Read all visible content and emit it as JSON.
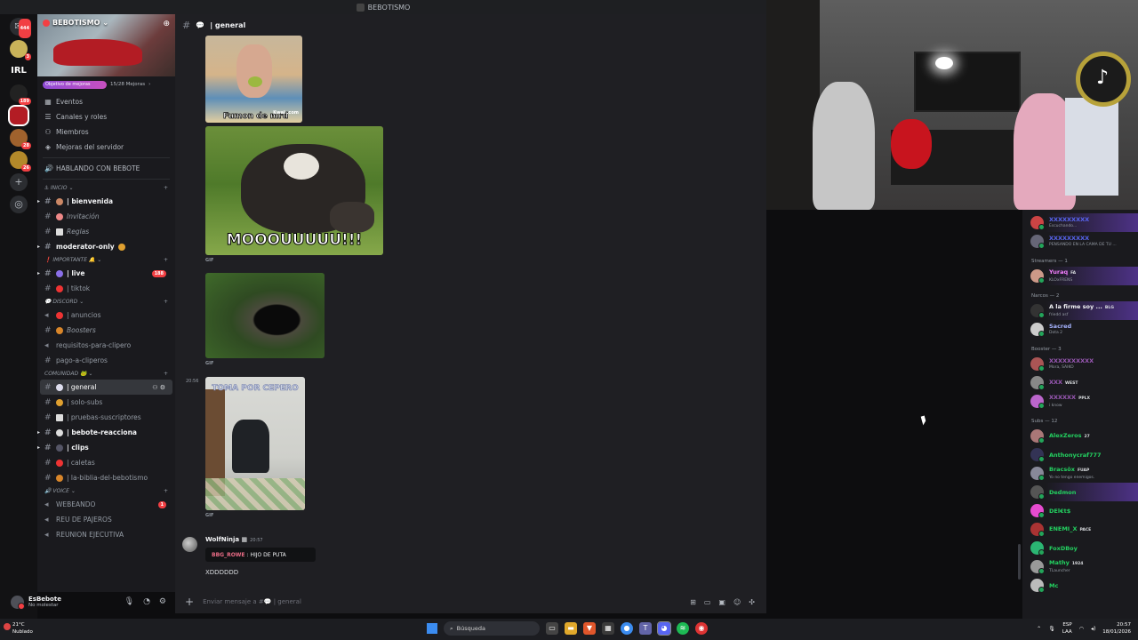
{
  "window": {
    "title": "BEBOTISMO"
  },
  "rail": {
    "badges": [
      "444",
      "3",
      "189",
      "28",
      "26"
    ],
    "irl_label": "IRL"
  },
  "server": {
    "name": "BEBOTISMO",
    "boost_goal": "Objetivo de mejoras",
    "boost_count": "15/28 Mejoras",
    "boost_progress": 0.54
  },
  "menu": [
    {
      "icon": "calendar-icon",
      "label": "Eventos"
    },
    {
      "icon": "list-icon",
      "label": "Canales y roles"
    },
    {
      "icon": "members-icon",
      "label": "Miembros"
    },
    {
      "icon": "boost-icon",
      "label": "Mejoras del servidor"
    }
  ],
  "hablando": "HABLANDO CON BEBOTE",
  "categories": {
    "inicio": "INICIO",
    "importante": "IMPORTANTE",
    "discord": "DISCORD",
    "comunidad": "COMUNIDAD",
    "voice": "VOICE"
  },
  "channels": {
    "bienvenida": "| bienvenida",
    "invitacion": "Invitación",
    "reglas": "Reglas",
    "moderator": "moderator-only",
    "live": "| live",
    "live_count": "188",
    "tiktok": "| tiktok",
    "anuncios": "| anuncios",
    "boosters": "Boosters",
    "requisitos": "requisitos-para-clipero",
    "pago": "pago-a-cliperos",
    "general": "| general",
    "solo_subs": "| solo-subs",
    "pruebas": "| pruebas-suscriptores",
    "reacciona": "| bebote-reacciona",
    "clips": "| clips",
    "caletas": "| caletas",
    "biblia": "| la-biblia-del-bebotismo",
    "webeando": "WEBEANDO",
    "webeando_count": "1",
    "reu": "REU DE PAJEROS",
    "reunion": "REUNION EJECUTIVA"
  },
  "user": {
    "name": "EsBebote",
    "status": "No molestar"
  },
  "chat": {
    "channel_name": "| general",
    "img1_watermark": "Fumon de mrd",
    "img1_wm_site": "Kwai .com",
    "cow_caption": "MOOOUUUUU!!!",
    "gif_label": "GIF",
    "ts_2056": "20:56",
    "room_caption": "TOMA POR CEPERO",
    "author": "WolfNinja",
    "author_time": "20:57",
    "reply_user": "BBG_ROWE",
    "reply_text": ": HIJO DE PUTA",
    "message": "XDDDDDD",
    "composer_placeholder": "Enviar mensaje a #💬 | general"
  },
  "members": {
    "top": [
      {
        "name": "XXXXXXXXX",
        "activity": "Escuchando...",
        "color": "#5865f2"
      },
      {
        "name": "XXXXXXXXX",
        "activity": "PENSANDO EN LA CAMA DE TU ...",
        "color": "#5865f2"
      }
    ],
    "streamers_header": "Streamers — 1",
    "streamers": [
      {
        "name": "Yuraq",
        "tag": "FA",
        "activity": "KLOxFRENS",
        "color": "#f47fff"
      }
    ],
    "narcos_header": "Narcos — 2",
    "narcos": [
      {
        "name": "A la firme soy ...",
        "tag": "BLG",
        "activity": "friedd asf",
        "color": "#f2f3f5"
      },
      {
        "name": "Sacred",
        "tag": "",
        "activity": "Dota 2",
        "color": "#a6b4ff"
      }
    ],
    "booster_header": "Booster — 3",
    "boosters": [
      {
        "name": "XXXXXXXXXX",
        "tag": "",
        "activity": "Mora, SAIKO",
        "color": "#9b59b6"
      },
      {
        "name": "XXX",
        "tag": "WEST",
        "activity": "",
        "color": "#9b59b6"
      },
      {
        "name": "XXXXXX",
        "tag": "PPLX",
        "activity": "i know",
        "color": "#9b59b6"
      }
    ],
    "subs_header": "Subs — 12",
    "subs": [
      {
        "name": "AlexZeros",
        "tag": "27",
        "activity": ""
      },
      {
        "name": "Anthonycraf777",
        "tag": "",
        "activity": ""
      },
      {
        "name": "Bracsôx",
        "tag": "FUAP",
        "activity": "Yo no tengo enemigos."
      },
      {
        "name": "Dedmon",
        "tag": "",
        "activity": ""
      },
      {
        "name": "DEl€t$",
        "tag": "",
        "activity": ""
      },
      {
        "name": "ENEMI_X",
        "tag": "PACE",
        "activity": ""
      },
      {
        "name": "FoxDBoy",
        "tag": "",
        "activity": ""
      },
      {
        "name": "Mathy",
        "tag": "1924",
        "activity": "TLauncher"
      },
      {
        "name": "Mc",
        "tag": "",
        "activity": ""
      }
    ]
  },
  "taskbar": {
    "temp": "21°C",
    "weather": "Nublado",
    "search": "Búsqueda",
    "lang1": "ESP",
    "lang2": "LAA",
    "time": "20:57",
    "date": "18/01/2026"
  },
  "colors": {
    "accent": "#5865f2",
    "sub_green": "#23d160",
    "mention_red": "#f23f43"
  }
}
